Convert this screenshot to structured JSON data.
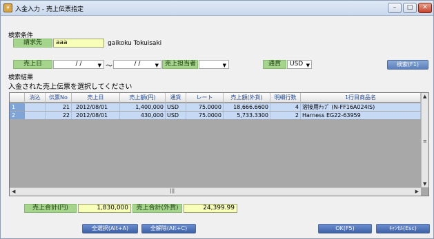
{
  "window": {
    "title": "入金入力 - 売上伝票指定",
    "min": "–",
    "max": "□",
    "close": "✕"
  },
  "search": {
    "section_label": "検索条件",
    "customer_label": "請求先",
    "customer_value": "aaa",
    "customer_name": "gaikoku Tokuisaki",
    "date_label": "売上日",
    "date_from": "/  /",
    "tilde": "～",
    "date_to": "/  /",
    "staff_label": "売上担当者",
    "currency_label": "通貨",
    "currency_value": "USD",
    "search_button": "検索(F1)"
  },
  "results": {
    "section_label": "検索結果",
    "instruction": "入金された売上伝票を選択してください",
    "columns": [
      "消込",
      "伝票No",
      "売上日",
      "売上額(円)",
      "通貨",
      "レート",
      "売上額(外貨)",
      "明細行数",
      "1行目商品名"
    ],
    "rows": [
      {
        "num": "1",
        "no": "21",
        "date": "2012/08/01",
        "yen": "1,400,000",
        "cur": "USD",
        "rate": "75.0000",
        "fx": "18,666.6600",
        "lines": "4",
        "item": "溶接用ﾁｯﾌﾟ (N-FF16A024IS)"
      },
      {
        "num": "2",
        "no": "22",
        "date": "2012/08/01",
        "yen": "430,000",
        "cur": "USD",
        "rate": "75.0000",
        "fx": "5,733.3300",
        "lines": "2",
        "item": "Harness EG22-63959"
      }
    ]
  },
  "totals": {
    "yen_label": "売上合計(円)",
    "yen_value": "1,830,000",
    "fx_label": "売上合計(外貨)",
    "fx_value": "24,399.99"
  },
  "buttons": {
    "select_all": "全選択(Alt+A)",
    "clear_all": "全解除(Alt+C)",
    "ok": "OK(F5)",
    "cancel": "ｷｬﾝｾﾙ(Esc)"
  },
  "icons": {
    "app": "app-icon",
    "dropdown": "chevron-down-icon"
  }
}
